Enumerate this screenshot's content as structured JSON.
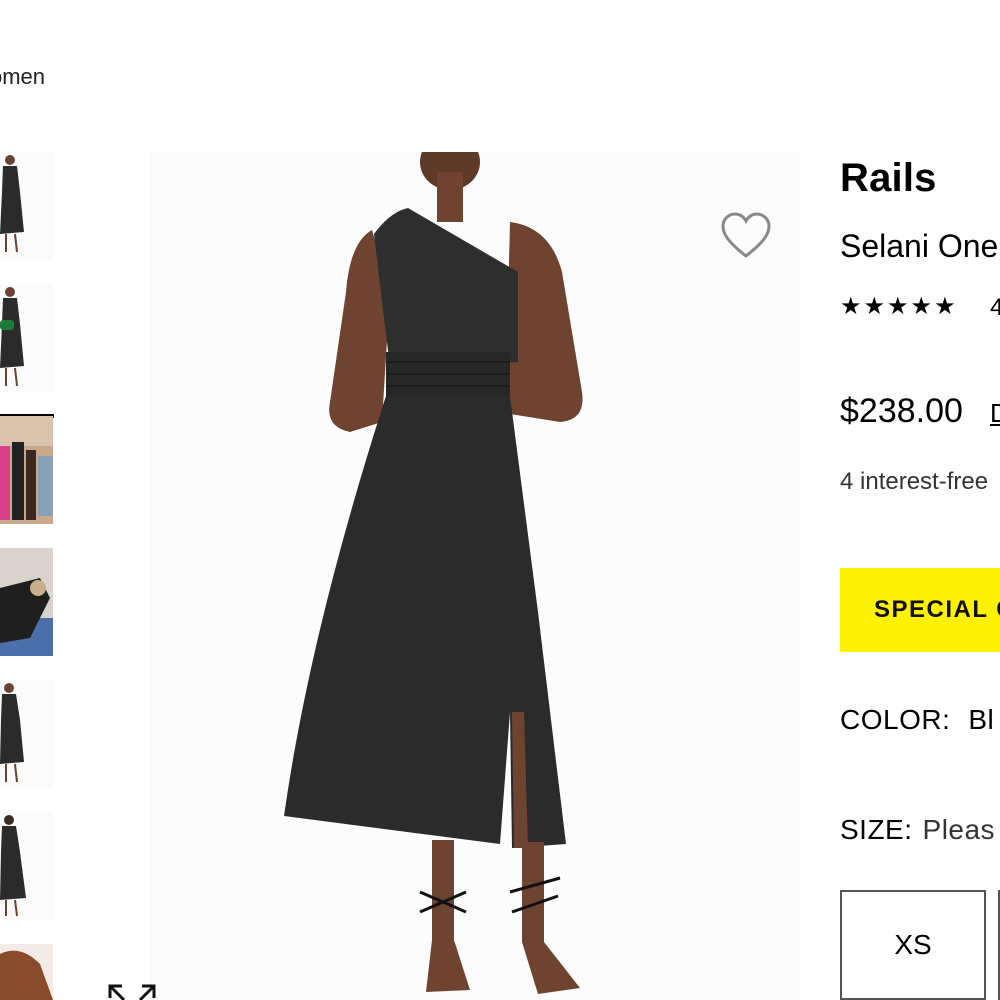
{
  "breadcrumb": {
    "text": "omen"
  },
  "gallery": {
    "thumbnails": [
      {
        "label": "black dress front view"
      },
      {
        "label": "black dress with green bag"
      },
      {
        "label": "lifestyle group photo"
      },
      {
        "label": "lifestyle lounging photo"
      },
      {
        "label": "black dress side view"
      },
      {
        "label": "black dress back view"
      },
      {
        "label": "close-up detail"
      }
    ],
    "selected_index": 0
  },
  "product": {
    "brand": "Rails",
    "name": "Selani One",
    "rating_stars": "★★★★★",
    "rating_value": 4.5,
    "rating_count_partial": "4",
    "price": "$238.00",
    "price_link_partial": "D",
    "installments": "4 interest-free"
  },
  "special_button": {
    "label": "SPECIAL C"
  },
  "color": {
    "label": "COLOR:",
    "value": "Bl"
  },
  "size": {
    "label": "SIZE:",
    "prompt": "Pleas",
    "options": [
      "XS"
    ]
  },
  "icons": {
    "heart": "heart-icon",
    "expand": "expand-icon"
  },
  "colors": {
    "accent_yellow": "#fff200",
    "dress": "#2b2b2b",
    "skin": "#7a4a32"
  }
}
